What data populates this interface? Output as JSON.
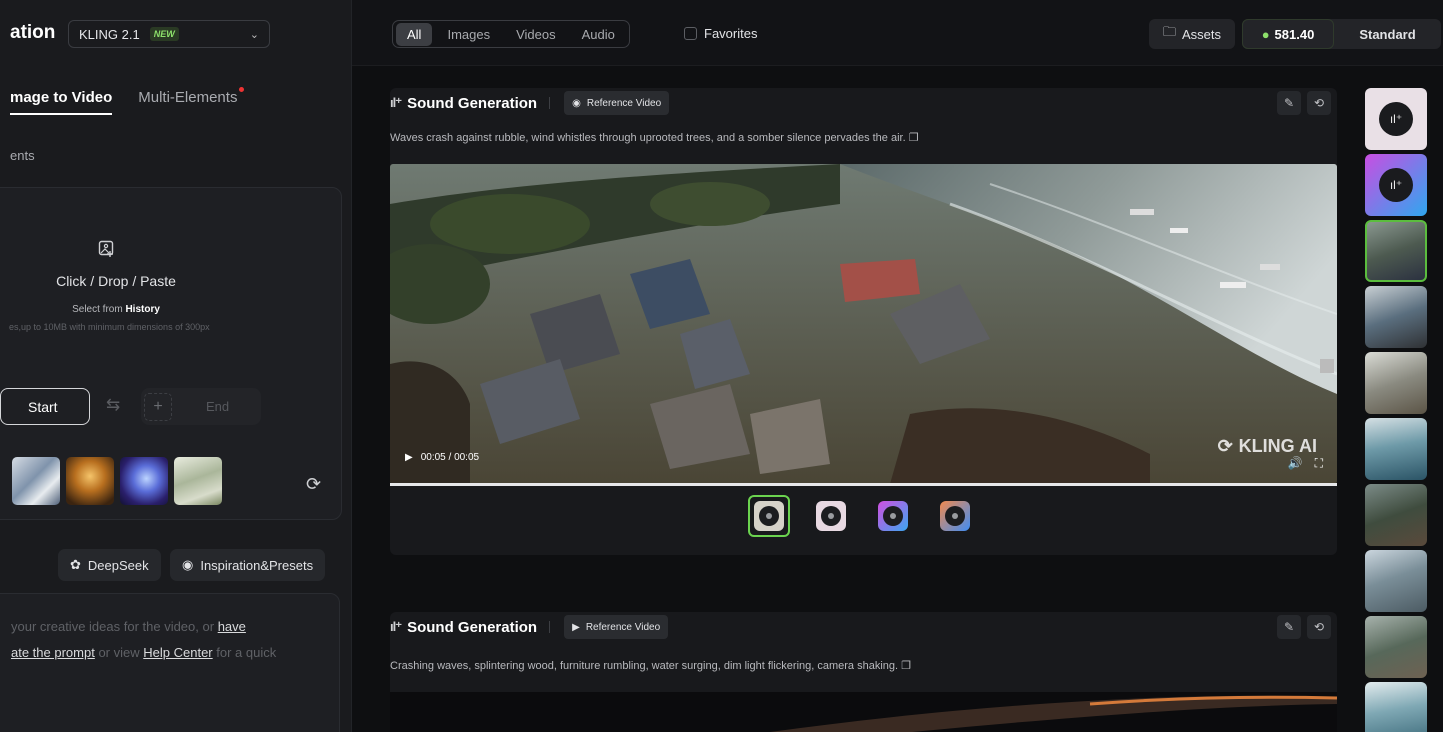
{
  "left": {
    "title_partial": "ation",
    "model": {
      "name": "KLING 2.1",
      "badge": "NEW"
    },
    "tabs": [
      {
        "label": "mage to Video",
        "active": true
      },
      {
        "label": "Multi-Elements",
        "active": false,
        "has_dot": true
      }
    ],
    "section_label": "ents",
    "upload": {
      "main": "Click / Drop / Paste",
      "history_prefix": "Select from",
      "history_link": "History",
      "limits": "es,up to 10MB with minimum dimensions of 300px"
    },
    "frames": {
      "start": "Start",
      "end": "End"
    },
    "tools": {
      "deepseek": "DeepSeek",
      "inspiration": "Inspiration&Presets"
    },
    "prompt": {
      "line1_prefix": "your creative ideas for the video, or",
      "line1_link": "have",
      "line2_link": "ate the prompt",
      "line2_mid": "or view",
      "line2_link2": "Help Center",
      "line2_suffix": "for a quick"
    }
  },
  "topbar": {
    "filters": [
      "All",
      "Images",
      "Videos",
      "Audio"
    ],
    "selected_filter": "All",
    "favorites": "Favorites",
    "assets": "Assets",
    "credits": "581.40",
    "plan": "Standard"
  },
  "cards": [
    {
      "title": "Sound Generation",
      "chip": "Reference Video",
      "description": "Waves crash against rubble, wind whistles through uprooted trees, and a somber silence pervades the air.",
      "time": "00:05 / 00:05",
      "watermark": "KLING AI",
      "progress": 1.0
    },
    {
      "title": "Sound Generation",
      "chip": "Reference Video",
      "description": "Crashing waves, splintering wood, furniture rumbling, water surging, dim light flickering, camera shaking."
    }
  ],
  "colors": {
    "accent_green": "#6bd34f",
    "panel_bg": "#1a1b1e",
    "page_bg": "#0e0f11"
  }
}
